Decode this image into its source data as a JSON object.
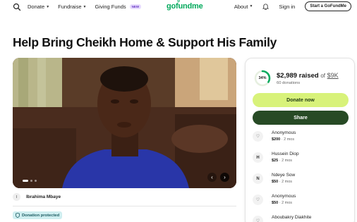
{
  "header": {
    "search_icon": "search-icon",
    "nav_left": [
      {
        "label": "Donate"
      },
      {
        "label": "Fundraise"
      },
      {
        "label": "Giving Funds",
        "badge": "NEW"
      }
    ],
    "logo_text": "gofundme",
    "nav_right": {
      "about": "About",
      "sign_in": "Sign in",
      "start_button": "Start a GoFundMe"
    }
  },
  "campaign": {
    "title": "Help Bring Cheikh Home & Support His Family",
    "organizer_initial": "I",
    "organizer_name": "Ibrahima Mbaye",
    "protected_label": "Donation protected"
  },
  "card": {
    "progress_percent": 34,
    "percent_label": "34%",
    "raised": "$2,989 raised",
    "of_word": "of",
    "goal": "$9K",
    "donations_count": "60 donations",
    "donate_button": "Donate now",
    "share_button": "Share",
    "donors": [
      {
        "icon": "heart-hand-icon",
        "name": "Anonymous",
        "amount": "$200",
        "time": "2 mos"
      },
      {
        "icon": "H",
        "name": "Hussein Diop",
        "amount": "$25",
        "time": "2 mos"
      },
      {
        "icon": "N",
        "name": "Ndeye Sow",
        "amount": "$50",
        "time": "2 mos"
      },
      {
        "icon": "heart-hand-icon",
        "name": "Anonymous",
        "amount": "$50",
        "time": "2 mos"
      },
      {
        "icon": "heart-hand-icon",
        "name": "Aboubakry Diakhite",
        "amount": "",
        "time": ""
      }
    ]
  },
  "colors": {
    "brand_green": "#02a95c",
    "donate_button": "#d8f27a",
    "share_button": "#274a25",
    "protected_badge": "#cfeef0"
  }
}
